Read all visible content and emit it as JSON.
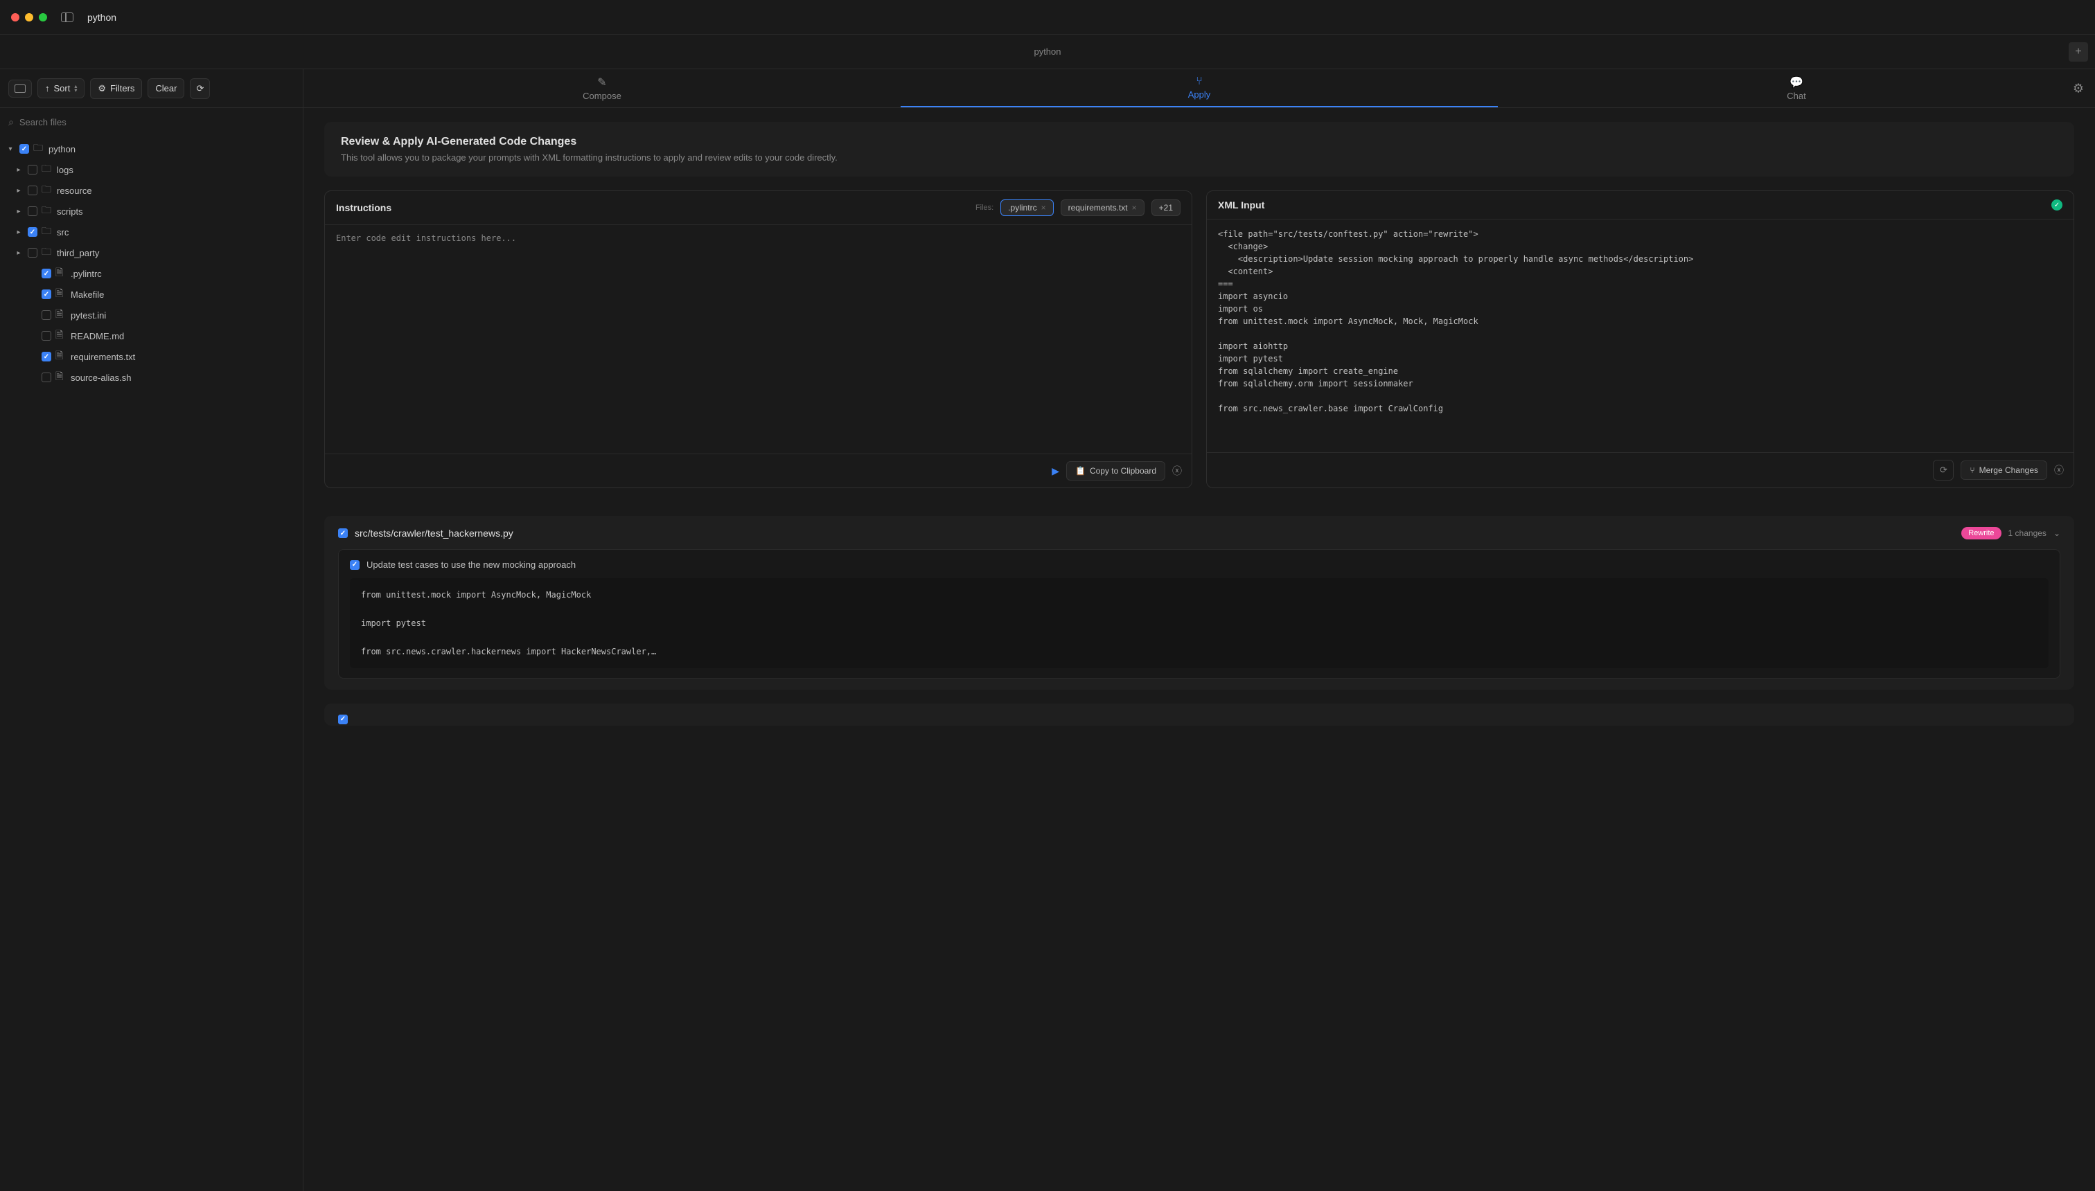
{
  "titlebar": {
    "title": "python"
  },
  "subtitle": "python",
  "toolbar": {
    "sort": "Sort",
    "filters": "Filters",
    "clear": "Clear"
  },
  "search": {
    "placeholder": "Search files"
  },
  "tree": {
    "root": "python",
    "items": [
      {
        "name": "logs",
        "type": "folder",
        "checked": false,
        "level": 1
      },
      {
        "name": "resource",
        "type": "folder",
        "checked": false,
        "level": 1
      },
      {
        "name": "scripts",
        "type": "folder",
        "checked": false,
        "level": 1
      },
      {
        "name": "src",
        "type": "folder",
        "checked": true,
        "level": 1
      },
      {
        "name": "third_party",
        "type": "folder",
        "checked": false,
        "level": 1
      },
      {
        "name": ".pylintrc",
        "type": "file",
        "checked": true,
        "level": 1
      },
      {
        "name": "Makefile",
        "type": "file",
        "checked": true,
        "level": 1
      },
      {
        "name": "pytest.ini",
        "type": "file",
        "checked": false,
        "level": 1
      },
      {
        "name": "README.md",
        "type": "file",
        "checked": false,
        "level": 1
      },
      {
        "name": "requirements.txt",
        "type": "file",
        "checked": true,
        "level": 1
      },
      {
        "name": "source-alias.sh",
        "type": "file",
        "checked": false,
        "level": 1
      }
    ]
  },
  "tabs": {
    "compose": "Compose",
    "apply": "Apply",
    "chat": "Chat"
  },
  "banner": {
    "title": "Review & Apply AI-Generated Code Changes",
    "subtitle": "This tool allows you to package your prompts with XML formatting instructions to apply and review edits to your code directly."
  },
  "instructions": {
    "title": "Instructions",
    "files_label": "Files:",
    "file_chips": [
      ".pylintrc",
      "requirements.txt"
    ],
    "more_chip": "+21",
    "placeholder": "Enter code edit instructions here...",
    "copy_btn": "Copy to Clipboard"
  },
  "xml_panel": {
    "title": "XML Input",
    "code": "<file path=\"src/tests/conftest.py\" action=\"rewrite\">\n  <change>\n    <description>Update session mocking approach to properly handle async methods</description>\n  <content>\n===\nimport asyncio\nimport os\nfrom unittest.mock import AsyncMock, Mock, MagicMock\n\nimport aiohttp\nimport pytest\nfrom sqlalchemy import create_engine\nfrom sqlalchemy.orm import sessionmaker\n\nfrom src.news_crawler.base import CrawlConfig",
    "merge_btn": "Merge Changes"
  },
  "changes": [
    {
      "path": "src/tests/crawler/test_hackernews.py",
      "badge": "Rewrite",
      "count": "1 changes",
      "desc": "Update test cases to use the new mocking approach",
      "code": "from unittest.mock import AsyncMock, MagicMock\n\nimport pytest\n\nfrom src.news.crawler.hackernews import HackerNewsCrawler,…"
    }
  ]
}
